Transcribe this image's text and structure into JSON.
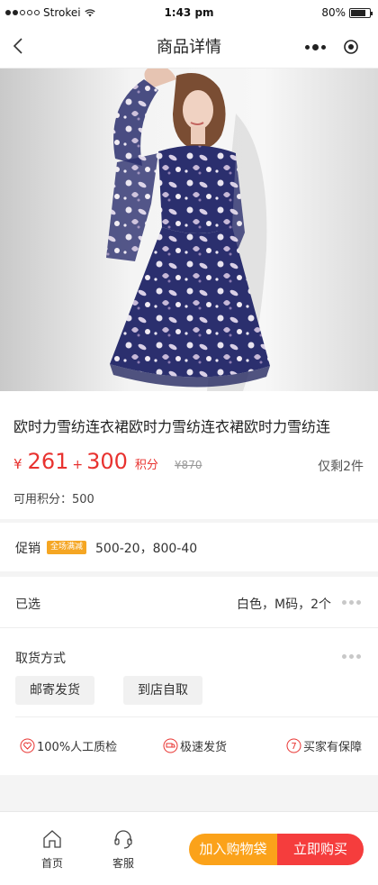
{
  "status_bar": {
    "carrier": "Strokei",
    "time": "1:43 pm",
    "battery": "80%",
    "battery_level": 0.8
  },
  "nav": {
    "title": "商品详情"
  },
  "product": {
    "title": "欧时力雪纺连衣裙欧时力雪纺连衣裙欧时力雪纺连",
    "currency": "¥",
    "price": "261",
    "plus": "+",
    "points": "300",
    "points_label": "积分",
    "original_price": "¥870",
    "stock": "仅剩2件",
    "available_points": "可用积分：500"
  },
  "promotion": {
    "label": "促销",
    "badge": "全场满减",
    "text": "500-20，800-40"
  },
  "selection": {
    "label": "已选",
    "value": "白色，M码，2个"
  },
  "pickup": {
    "label": "取货方式",
    "options": [
      "邮寄发货",
      "到店自取"
    ]
  },
  "guarantees": [
    "100%人工质检",
    "极速发货",
    "买家有保障"
  ],
  "guarantee_badge": "7",
  "tabbar": {
    "home": "首页",
    "service": "客服",
    "add_to_cart": "加入购物袋",
    "buy_now": "立即购买"
  },
  "colors": {
    "price_red": "#e8322f",
    "cart_orange": "#fba21a",
    "buy_red": "#f53d3d",
    "badge_orange": "#f5a623"
  }
}
